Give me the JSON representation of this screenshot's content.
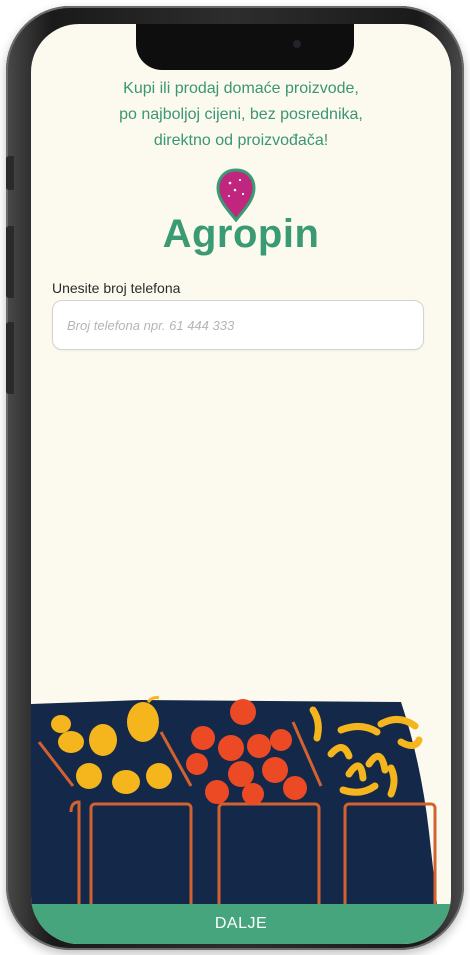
{
  "tagline": {
    "line1": "Kupi ili prodaj domaće proizvode,",
    "line2": "po najboljoj cijeni, bez posrednika,",
    "line3": "direktno od proizvođača!"
  },
  "logo": {
    "name": "Agropin",
    "icon": "map-pin-icon"
  },
  "phone_field": {
    "label": "Unesite broj telefona",
    "placeholder": "Broj telefona npr. 61 444 333",
    "value": ""
  },
  "next_button": {
    "label": "DALJE"
  },
  "colors": {
    "brand_green": "#3a9a73",
    "button_green": "#46a57c",
    "background": "#fcfaef",
    "pin_magenta": "#c0267e",
    "stall_navy": "#14284a"
  }
}
